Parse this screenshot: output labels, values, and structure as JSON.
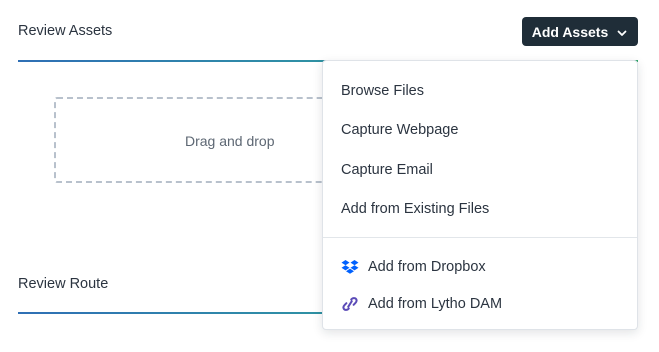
{
  "assets_section": {
    "title": "Review Assets",
    "add_button_label": "Add Assets",
    "dropzone_text": "Drag and drop"
  },
  "route_section": {
    "title": "Review Route"
  },
  "add_assets_menu": {
    "items": [
      {
        "label": "Browse Files"
      },
      {
        "label": "Capture Webpage"
      },
      {
        "label": "Capture Email"
      },
      {
        "label": "Add from Existing Files"
      },
      {
        "label": "Add from Dropbox",
        "icon": "dropbox-icon"
      },
      {
        "label": "Add from Lytho DAM",
        "icon": "link-icon"
      }
    ]
  },
  "colors": {
    "button_bg": "#1f2d38",
    "accent_blue": "#2f6fb5",
    "accent_green": "#2fa66a",
    "dropbox_blue": "#0061fe",
    "lytho_purple": "#5b4bb7"
  }
}
